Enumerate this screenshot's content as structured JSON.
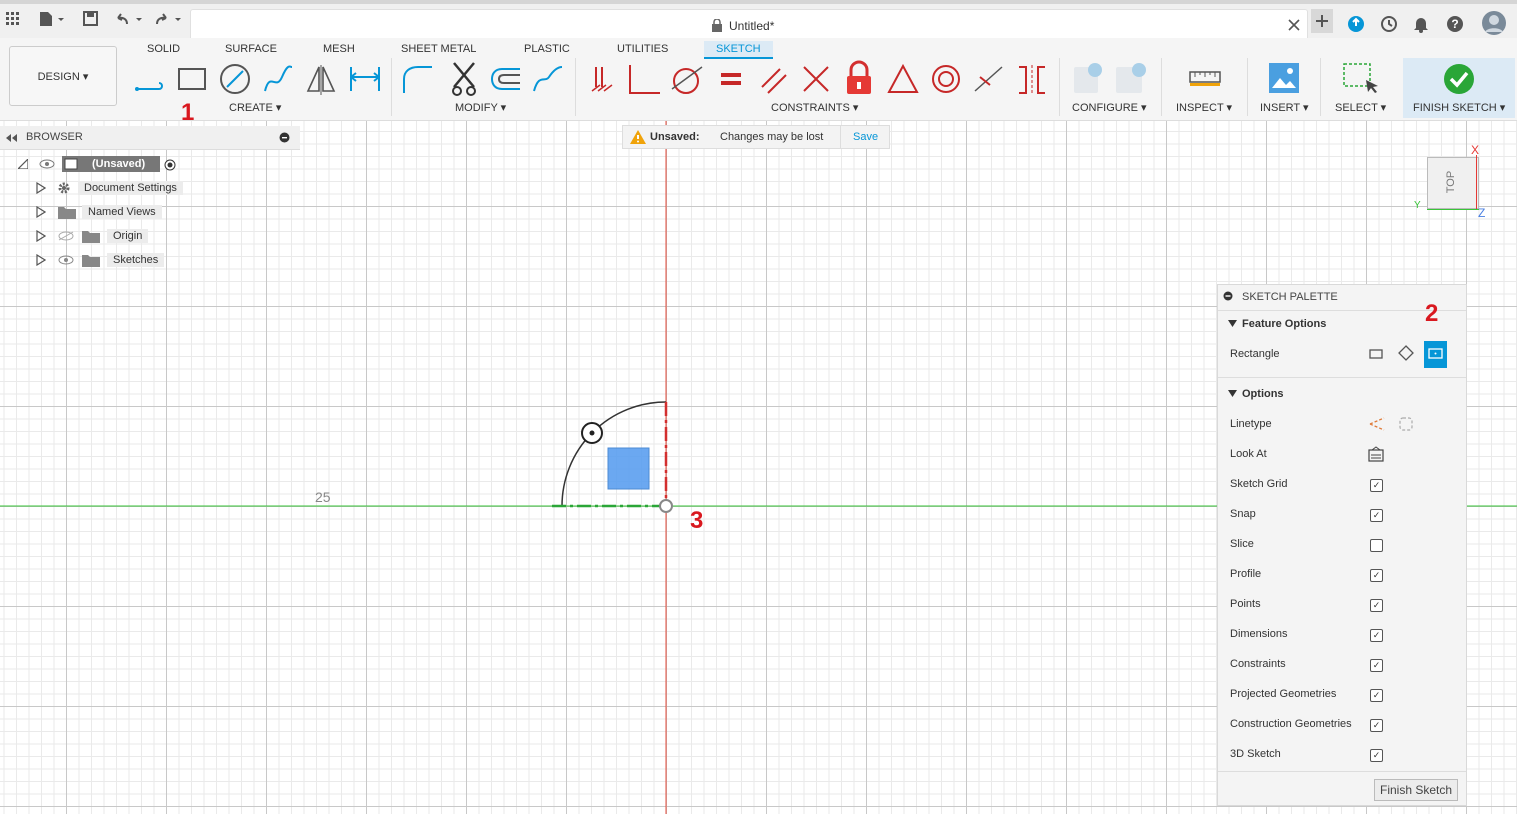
{
  "topbar": {
    "title": "Untitled*"
  },
  "ribbon": {
    "workspace": "DESIGN",
    "tabs": [
      "SOLID",
      "SURFACE",
      "MESH",
      "SHEET METAL",
      "PLASTIC",
      "UTILITIES",
      "SKETCH"
    ],
    "active_tab": "SKETCH",
    "groups": {
      "create": "CREATE",
      "modify": "MODIFY",
      "constraints": "CONSTRAINTS",
      "configure": "CONFIGURE",
      "inspect": "INSPECT",
      "insert": "INSERT",
      "select": "SELECT",
      "finish": "FINISH SKETCH"
    }
  },
  "browser": {
    "title": "BROWSER",
    "root": "(Unsaved)",
    "items": [
      "Document Settings",
      "Named Views",
      "Origin",
      "Sketches"
    ]
  },
  "notice": {
    "label": "Unsaved:",
    "message": "Changes may be lost",
    "action": "Save"
  },
  "canvas": {
    "dimension": "25"
  },
  "viewcube": {
    "face": "TOP",
    "x": "X",
    "y": "Y",
    "z": "Z"
  },
  "palette": {
    "title": "SKETCH PALETTE",
    "feature_options": "Feature Options",
    "rectangle": "Rectangle",
    "options": "Options",
    "linetype": "Linetype",
    "look_at": "Look At",
    "rows": [
      {
        "label": "Sketch Grid",
        "checked": true
      },
      {
        "label": "Snap",
        "checked": true
      },
      {
        "label": "Slice",
        "checked": false
      },
      {
        "label": "Profile",
        "checked": true
      },
      {
        "label": "Points",
        "checked": true
      },
      {
        "label": "Dimensions",
        "checked": true
      },
      {
        "label": "Constraints",
        "checked": true
      },
      {
        "label": "Projected Geometries",
        "checked": true
      },
      {
        "label": "Construction Geometries",
        "checked": true
      },
      {
        "label": "3D Sketch",
        "checked": true
      }
    ],
    "finish_button": "Finish Sketch"
  },
  "annotations": {
    "one": "1",
    "two": "2",
    "three": "3"
  },
  "colors": {
    "accent": "#0696d7",
    "finish_green": "#2aa637",
    "annotation_red": "#d9181f"
  }
}
